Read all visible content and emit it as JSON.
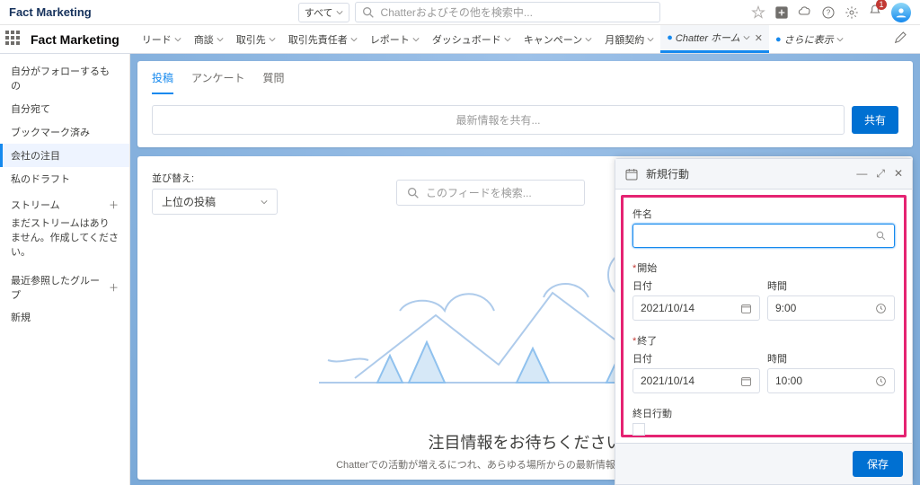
{
  "header": {
    "org": "Fact Marketing",
    "scope": "すべて",
    "search_placeholder": "Chatterおよびその他を検索中...",
    "notif_count": "1"
  },
  "nav": {
    "app": "Fact Marketing",
    "items": [
      "リード",
      "商談",
      "取引先",
      "取引先責任者",
      "レポート",
      "ダッシュボード",
      "キャンペーン",
      "月額契約"
    ],
    "active_tab": "Chatter ホーム",
    "more": "さらに表示"
  },
  "sidebar": {
    "items": [
      "自分がフォローするもの",
      "自分宛て",
      "ブックマーク済み",
      "会社の注目",
      "私のドラフト"
    ],
    "selected_index": 3,
    "streams_label": "ストリーム",
    "streams_empty": "まだストリームはありません。作成してください。",
    "groups_label": "最近参照したグループ",
    "new_label": "新規"
  },
  "publisher": {
    "tabs": [
      "投稿",
      "アンケート",
      "質問"
    ],
    "placeholder": "最新情報を共有...",
    "share": "共有"
  },
  "feed": {
    "sort_label": "並び替え:",
    "sort_value": "上位の投稿",
    "search_placeholder": "このフィードを検索...",
    "empty_title": "注目情報をお待ちください",
    "empty_sub": "Chatterでの活動が増えるにつれ、あらゆる場所からの最新情報がここに表示されます"
  },
  "panel": {
    "title": "新規行動",
    "subject_label": "件名",
    "start_label": "開始",
    "end_label": "終了",
    "date_label": "日付",
    "time_label": "時間",
    "start_date": "2021/10/14",
    "start_time": "9:00",
    "end_date": "2021/10/14",
    "end_time": "10:00",
    "allday_label": "終日行動",
    "save": "保存"
  }
}
